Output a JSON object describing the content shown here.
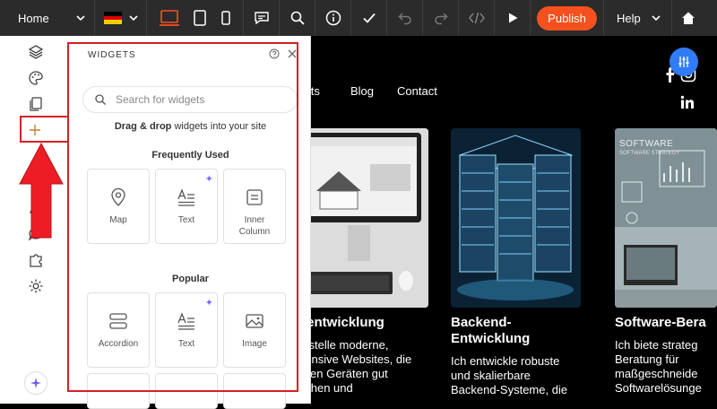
{
  "topbar": {
    "page_select": "Home",
    "publish_label": "Publish",
    "help_label": "Help"
  },
  "panel": {
    "title": "WIDGETS",
    "search_placeholder": "Search for widgets",
    "hint_bold": "Drag & drop",
    "hint_rest": " widgets into your site",
    "section_frequent": "Frequently Used",
    "section_popular": "Popular",
    "frequent": [
      {
        "label": "Map",
        "icon": "map-pin-icon"
      },
      {
        "label": "Text",
        "icon": "text-icon"
      },
      {
        "label": "Inner Column",
        "icon": "inner-column-icon"
      }
    ],
    "popular": [
      {
        "label": "Accordion",
        "icon": "accordion-icon"
      },
      {
        "label": "Text",
        "icon": "text-icon"
      },
      {
        "label": "Image",
        "icon": "image-icon"
      }
    ]
  },
  "canvas": {
    "nav": [
      "ects",
      "Blog",
      "Contact"
    ],
    "cards": [
      {
        "title": "bentwicklung",
        "body": [
          "erstelle moderne,",
          "ponsive Websites, die",
          "allen Geräten gut",
          "sehen und"
        ]
      },
      {
        "title": [
          "Backend-",
          "Entwicklung"
        ],
        "body": [
          "Ich entwickle robuste",
          "und skalierbare",
          "Backend-Systeme, die"
        ]
      },
      {
        "title": "Software-Bera",
        "body": [
          "Ich biete strateg",
          "Beratung für",
          "maßgeschneide",
          "Softwarelösunge"
        ]
      }
    ],
    "img3_text": [
      "SOFTWARE",
      "SOFTWARE STRATEGY"
    ]
  },
  "colors": {
    "accent": "#f4511e",
    "annotation": "#d52027",
    "settings_fab": "#2f7cf6"
  }
}
